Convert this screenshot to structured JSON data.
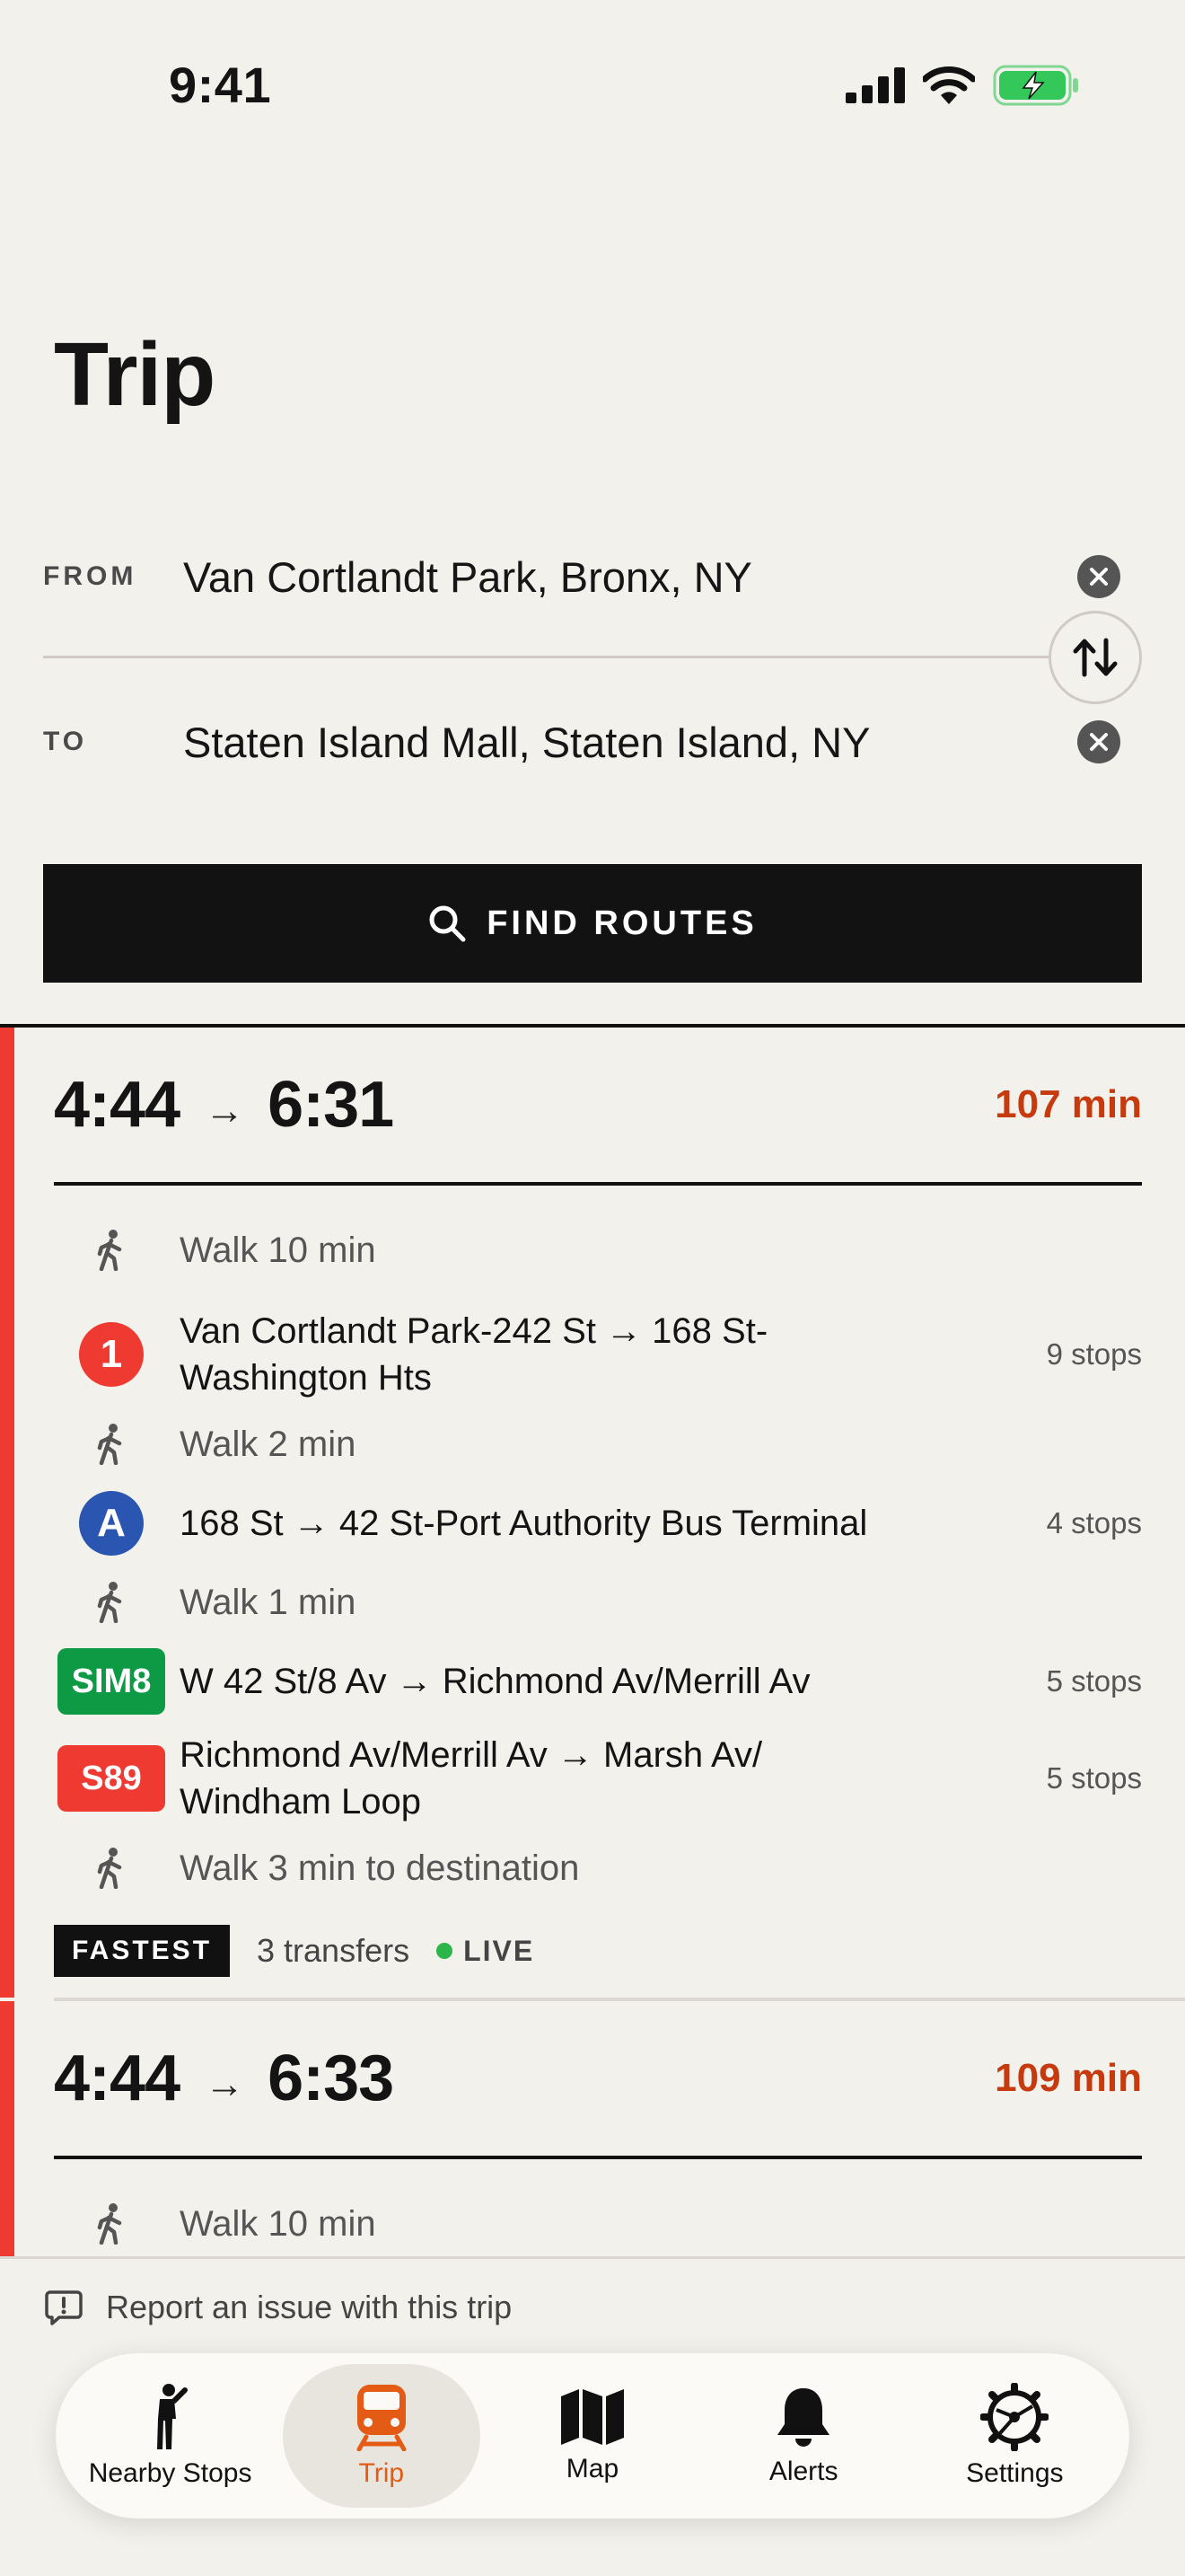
{
  "status_bar": {
    "time": "9:41"
  },
  "title": "Trip",
  "from": {
    "label": "FROM",
    "value": "Van Cortlandt Park, Bronx, NY"
  },
  "to": {
    "label": "TO",
    "value": "Staten Island Mall, Staten Island, NY"
  },
  "find_button": {
    "label": "FIND ROUTES"
  },
  "routes": [
    {
      "depart": "4:44",
      "arrow": "→",
      "arrive": "6:31",
      "duration": "107 min",
      "legs": [
        {
          "type": "walk",
          "text": "Walk 10 min"
        },
        {
          "type": "transit",
          "badge": "1",
          "badge_color": "#ee3a31",
          "text": "Van Cortlandt Park-242 St → 168 St-Washington Hts",
          "stops": "9 stops"
        },
        {
          "type": "walk",
          "text": "Walk 2 min"
        },
        {
          "type": "transit",
          "badge": "A",
          "badge_color": "#2a55b0",
          "text": "168 St → 42 St-Port Authority Bus Terminal",
          "stops": "4 stops"
        },
        {
          "type": "walk",
          "text": "Walk 1 min"
        },
        {
          "type": "bus",
          "badge": "SIM8",
          "badge_color": "#0e9a45",
          "text": "W 42 St/8 Av → Richmond Av/Merrill Av",
          "stops": "5 stops"
        },
        {
          "type": "bus",
          "badge": "S89",
          "badge_color": "#ee3a31",
          "text": "Richmond Av/Merrill Av → Marsh Av/ Windham Loop",
          "stops": "5 stops"
        },
        {
          "type": "walk",
          "text": "Walk 3 min to destination"
        }
      ],
      "tag": "FASTEST",
      "transfers": "3 transfers",
      "live": "LIVE"
    },
    {
      "depart": "4:44",
      "arrow": "→",
      "arrive": "6:33",
      "duration": "109 min",
      "legs": [
        {
          "type": "walk",
          "text": "Walk 10 min"
        }
      ]
    }
  ],
  "report": {
    "text": "Report an issue with this trip"
  },
  "tabs": [
    {
      "label": "Nearby Stops",
      "icon": "person-icon",
      "active": false
    },
    {
      "label": "Trip",
      "icon": "train-icon",
      "active": true
    },
    {
      "label": "Map",
      "icon": "map-icon",
      "active": false
    },
    {
      "label": "Alerts",
      "icon": "bell-icon",
      "active": false
    },
    {
      "label": "Settings",
      "icon": "gear-icon",
      "active": false
    }
  ],
  "colors": {
    "accent": "#e35b15",
    "duration": "#c63a0e",
    "route_bar": "#ee3a31",
    "live": "#2bb54a"
  }
}
